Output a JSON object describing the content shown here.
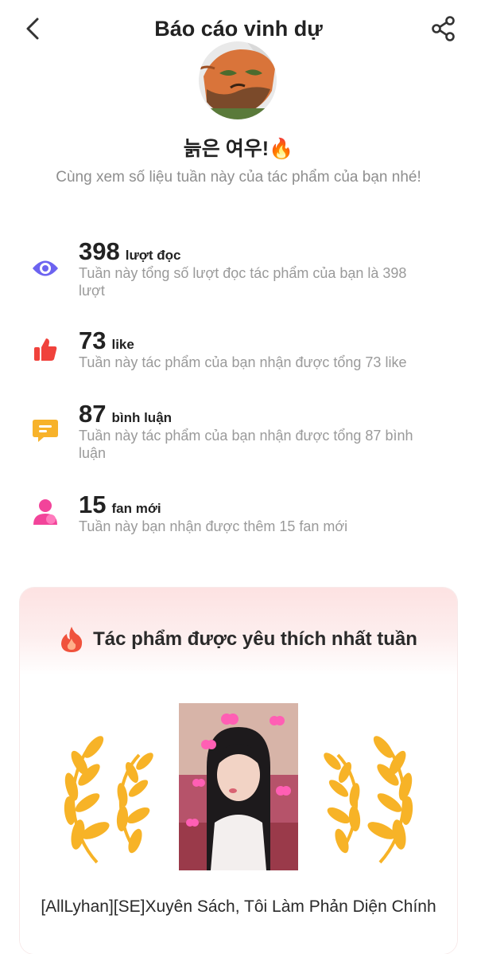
{
  "header": {
    "title": "Báo cáo vinh dự",
    "back_icon": "chevron-left-icon",
    "share_icon": "share-icon"
  },
  "profile": {
    "username": "늙은 여우!🔥",
    "subtitle": "Cùng xem số liệu tuần này của tác phẩm của bạn nhé!"
  },
  "stats": [
    {
      "icon": "eye-icon",
      "color": "#6c63f0",
      "value": "398",
      "unit": "lượt đọc",
      "description": "Tuần này tổng số lượt đọc tác phẩm của bạn là 398 lượt"
    },
    {
      "icon": "thumbs-up-icon",
      "color": "#f0423c",
      "value": "73",
      "unit": "like",
      "description": "Tuần này tác phẩm của bạn nhận được tổng 73 like"
    },
    {
      "icon": "comment-icon",
      "color": "#f7b22a",
      "value": "87",
      "unit": "bình luận",
      "description": "Tuần này tác phẩm của bạn nhận được tổng 87 bình luận"
    },
    {
      "icon": "user-icon",
      "color": "#f2449a",
      "value": "15",
      "unit": "fan mới",
      "description": "Tuần này bạn nhận được thêm 15 fan mới"
    }
  ],
  "favorite": {
    "title": "Tác phẩm được yêu thích nhất tuần",
    "icon": "flame-icon",
    "book_title": "[AllLyhan][SE]Xuyên Sách, Tôi Làm Phản Diện Chính"
  },
  "colors": {
    "accent_gold": "#f5a623",
    "flame": "#f0523c",
    "card_gradient_top": "#fde2e2"
  }
}
